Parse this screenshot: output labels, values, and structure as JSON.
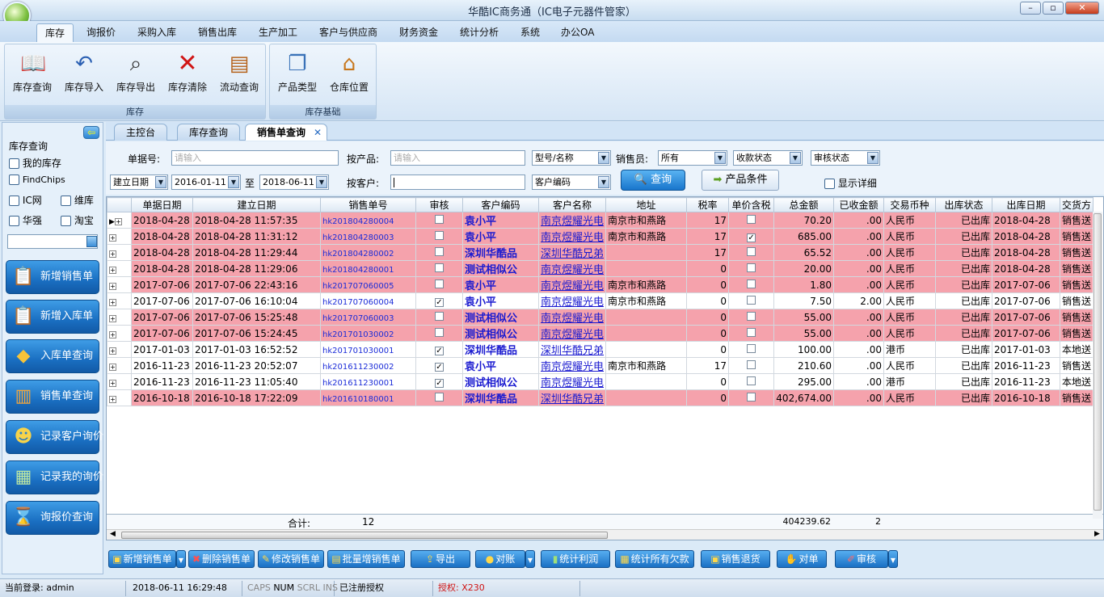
{
  "window": {
    "title": "华酷IC商务通（IC电子元器件管家）",
    "min": "–",
    "max": "▫",
    "close": "✕"
  },
  "menu": [
    "库存",
    "询报价",
    "采购入库",
    "销售出库",
    "生产加工",
    "客户与供应商",
    "财务资金",
    "统计分析",
    "系统",
    "办公OA"
  ],
  "ribbon": {
    "group1_label": "库存",
    "group1": [
      "库存查询",
      "库存导入",
      "库存导出",
      "库存清除",
      "流动查询"
    ],
    "group2_label": "库存基础",
    "group2": [
      "产品类型",
      "仓库位置"
    ]
  },
  "left": {
    "section_title": "库存查询",
    "my_stock": "我的库存",
    "findchips": "FindChips",
    "icnet": "IC网",
    "weiku": "维库",
    "huaqiang": "华强",
    "taobao": "淘宝",
    "buttons": [
      "新增销售单",
      "新增入库单",
      "入库单查询",
      "销售单查询",
      "记录客户询价",
      "记录我的询价",
      "询报价查询"
    ]
  },
  "doc_tabs": [
    "主控台",
    "库存查询",
    "销售单查询"
  ],
  "filters": {
    "order_no_label": "单据号:",
    "order_no_placeholder": "请输入",
    "product_label": "按产品:",
    "product_placeholder": "请输入",
    "model_select": "型号/名称",
    "seller_label": "销售员:",
    "seller_value": "所有",
    "pay_status": "收款状态",
    "audit_status": "审核状态",
    "date_type": "建立日期",
    "date_from": "2016-01-11",
    "to_label": "至",
    "date_to": "2018-06-11",
    "customer_label": "按客户:",
    "customer_value": "",
    "customer_select": "客户编码",
    "query_btn": "查询",
    "cond_btn": "产品条件",
    "show_detail": "显示详细"
  },
  "grid": {
    "columns": [
      "单据日期",
      "建立日期",
      "销售单号",
      "审核",
      "客户编码",
      "客户名称",
      "地址",
      "税率",
      "单价含税",
      "总金额",
      "已收金额",
      "交易币种",
      "出库状态",
      "出库日期",
      "交货方"
    ],
    "rows": [
      {
        "d": "2018-04-28",
        "c": "2018-04-28 11:57:35",
        "no": "hk201804280004",
        "audit": false,
        "code": "袁小平",
        "name": "南京煜耀光电",
        "addr": "南京市和燕路",
        "tax": "17",
        "incl": false,
        "total": "70.20",
        "recv": ".00",
        "cur": "人民币",
        "status": "已出库",
        "outd": "2018-04-28",
        "deliv": "销售送",
        "pink": true
      },
      {
        "d": "2018-04-28",
        "c": "2018-04-28 11:31:12",
        "no": "hk201804280003",
        "audit": false,
        "code": "袁小平",
        "name": "南京煜耀光电",
        "addr": "南京市和燕路",
        "tax": "17",
        "incl": true,
        "total": "685.00",
        "recv": ".00",
        "cur": "人民币",
        "status": "已出库",
        "outd": "2018-04-28",
        "deliv": "销售送",
        "pink": true
      },
      {
        "d": "2018-04-28",
        "c": "2018-04-28 11:29:44",
        "no": "hk201804280002",
        "audit": false,
        "code": "深圳华酷品",
        "name": "深圳华酷兄弟",
        "addr": "",
        "tax": "17",
        "incl": false,
        "total": "65.52",
        "recv": ".00",
        "cur": "人民币",
        "status": "已出库",
        "outd": "2018-04-28",
        "deliv": "销售送",
        "pink": true
      },
      {
        "d": "2018-04-28",
        "c": "2018-04-28 11:29:06",
        "no": "hk201804280001",
        "audit": false,
        "code": "测试相似公",
        "name": "南京煜耀光电",
        "addr": "",
        "tax": "0",
        "incl": false,
        "total": "20.00",
        "recv": ".00",
        "cur": "人民币",
        "status": "已出库",
        "outd": "2018-04-28",
        "deliv": "销售送",
        "pink": true
      },
      {
        "d": "2017-07-06",
        "c": "2017-07-06 22:43:16",
        "no": "hk201707060005",
        "audit": false,
        "code": "袁小平",
        "name": "南京煜耀光电",
        "addr": "南京市和燕路",
        "tax": "0",
        "incl": false,
        "total": "1.80",
        "recv": ".00",
        "cur": "人民币",
        "status": "已出库",
        "outd": "2017-07-06",
        "deliv": "销售送",
        "pink": true
      },
      {
        "d": "2017-07-06",
        "c": "2017-07-06 16:10:04",
        "no": "hk201707060004",
        "audit": true,
        "code": "袁小平",
        "name": "南京煜耀光电",
        "addr": "南京市和燕路",
        "tax": "0",
        "incl": false,
        "total": "7.50",
        "recv": "2.00",
        "cur": "人民币",
        "status": "已出库",
        "outd": "2017-07-06",
        "deliv": "销售送",
        "pink": false
      },
      {
        "d": "2017-07-06",
        "c": "2017-07-06 15:25:48",
        "no": "hk201707060003",
        "audit": false,
        "code": "测试相似公",
        "name": "南京煜耀光电",
        "addr": "",
        "tax": "0",
        "incl": false,
        "total": "55.00",
        "recv": ".00",
        "cur": "人民币",
        "status": "已出库",
        "outd": "2017-07-06",
        "deliv": "销售送",
        "pink": true
      },
      {
        "d": "2017-07-06",
        "c": "2017-07-06 15:24:45",
        "no": "hk201701030002",
        "audit": false,
        "code": "测试相似公",
        "name": "南京煜耀光电",
        "addr": "",
        "tax": "0",
        "incl": false,
        "total": "55.00",
        "recv": ".00",
        "cur": "人民币",
        "status": "已出库",
        "outd": "2017-07-06",
        "deliv": "销售送",
        "pink": true
      },
      {
        "d": "2017-01-03",
        "c": "2017-01-03 16:52:52",
        "no": "hk201701030001",
        "audit": true,
        "code": "深圳华酷品",
        "name": "深圳华酷兄弟",
        "addr": "",
        "tax": "0",
        "incl": false,
        "total": "100.00",
        "recv": ".00",
        "cur": "港币",
        "status": "已出库",
        "outd": "2017-01-03",
        "deliv": "本地送",
        "pink": false
      },
      {
        "d": "2016-11-23",
        "c": "2016-11-23 20:52:07",
        "no": "hk201611230002",
        "audit": true,
        "code": "袁小平",
        "name": "南京煜耀光电",
        "addr": "南京市和燕路",
        "tax": "17",
        "incl": false,
        "total": "210.60",
        "recv": ".00",
        "cur": "人民币",
        "status": "已出库",
        "outd": "2016-11-23",
        "deliv": "销售送",
        "pink": false
      },
      {
        "d": "2016-11-23",
        "c": "2016-11-23 11:05:40",
        "no": "hk201611230001",
        "audit": true,
        "code": "测试相似公",
        "name": "南京煜耀光电",
        "addr": "",
        "tax": "0",
        "incl": false,
        "total": "295.00",
        "recv": ".00",
        "cur": "港币",
        "status": "已出库",
        "outd": "2016-11-23",
        "deliv": "本地送",
        "pink": false
      },
      {
        "d": "2016-10-18",
        "c": "2016-10-18 17:22:09",
        "no": "hk201610180001",
        "audit": false,
        "code": "深圳华酷品",
        "name": "深圳华酷兄弟",
        "addr": "",
        "tax": "0",
        "incl": false,
        "total": "402,674.00",
        "recv": ".00",
        "cur": "人民币",
        "status": "已出库",
        "outd": "2016-10-18",
        "deliv": "销售送",
        "pink": true
      }
    ],
    "sum_label": "合计:",
    "sum_count": "12",
    "sum_total": "404239.62",
    "sum_recv": "2"
  },
  "actions": [
    "新增销售单",
    "删除销售单",
    "修改销售单",
    "批量增销售单",
    "导出",
    "对账",
    "统计利润",
    "统计所有欠款",
    "销售退货",
    "对单",
    "审核"
  ],
  "status": {
    "login": "当前登录: admin",
    "datetime": "2018-06-11 16:29:48",
    "caps": "CAPS",
    "num": "NUM",
    "scrl": "SCRL",
    "ins": "INS",
    "registered": "已注册授权",
    "license": "授权: X230"
  },
  "colors": {
    "pink_row": "#f5a2ac",
    "accent_blue": "#1a70c4",
    "link_blue": "#1a1ad0"
  }
}
